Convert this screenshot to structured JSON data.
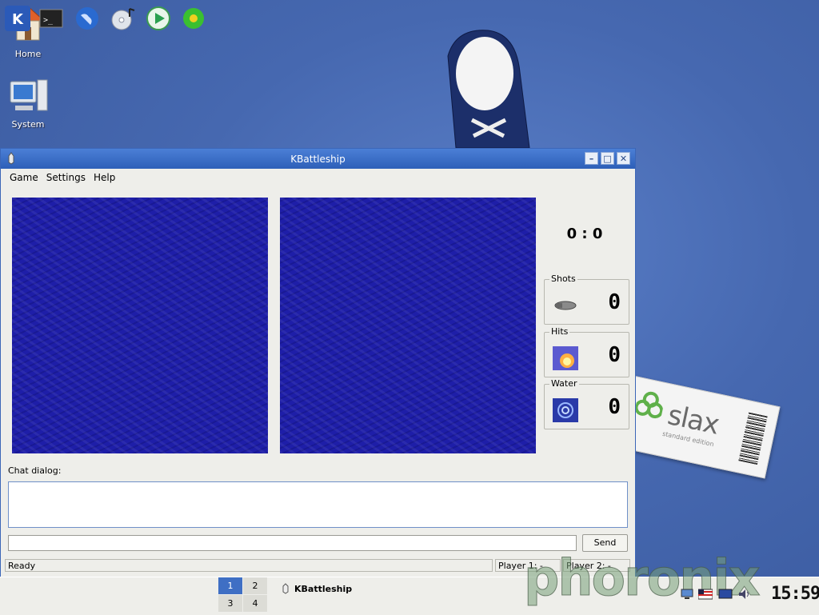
{
  "desktop": {
    "icons": [
      {
        "label": "Home",
        "icon": "home-folder-icon"
      },
      {
        "label": "System",
        "icon": "computer-icon"
      }
    ],
    "tag": {
      "brand": "slax",
      "subtitle": "standard edition"
    }
  },
  "window": {
    "title": "KBattleship",
    "controls": {
      "minimize": "–",
      "maximize": "□",
      "close": "✕"
    },
    "menu": [
      "Game",
      "Settings",
      "Help"
    ],
    "score": "0 : 0",
    "stats": [
      {
        "label": "Shots",
        "value": "0",
        "icon": "shell-icon"
      },
      {
        "label": "Hits",
        "value": "0",
        "icon": "explosion-icon"
      },
      {
        "label": "Water",
        "value": "0",
        "icon": "splash-icon"
      }
    ],
    "chat": {
      "label": "Chat dialog:",
      "input_value": "",
      "send_label": "Send"
    },
    "status": {
      "left": "Ready",
      "player1": "Player 1: -",
      "player2": "Player 2: -"
    }
  },
  "taskbar": {
    "pager": [
      "1",
      "2",
      "3",
      "4"
    ],
    "active_task": "KBattleship",
    "clock": "15:59",
    "watermark": "phoronix"
  }
}
